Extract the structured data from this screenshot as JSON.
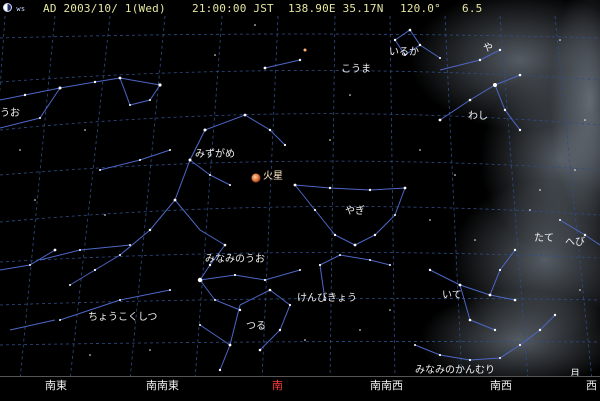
{
  "statusbar": {
    "moon_age": " ws",
    "date": "AD 2003/10/ 1(Wed)",
    "time": "21:00:00 JST",
    "coords": "138.90E 35.17N",
    "view_angle": "120.0°",
    "limit_mag": "6.5"
  },
  "labels": {
    "uo": "うお",
    "kouma": "こうま",
    "iruka": "いるか",
    "ya": "や",
    "washi": "わし",
    "mizugame": "みずがめ",
    "mars": "火星",
    "yagi": "やぎ",
    "tate": "たて",
    "hebi": "へび",
    "minaminouo": "みなみのうお",
    "kenbikyou": "けんびきょう",
    "ite": "いて",
    "choukokushitsu": "ちょうこくしつ",
    "tsuru": "つる",
    "minaminokanmuri": "みなみのかんむり",
    "tsuki": "月"
  },
  "directions": {
    "se": "南東",
    "sse": "南南東",
    "s": "南",
    "ssw": "南南西",
    "sw": "南西",
    "w_partial": "西"
  },
  "colors": {
    "background": "#000000",
    "grid": "#2f4d86",
    "constellation_lines": "#4d67c7",
    "milky_way": "#8e9aa8",
    "mars": "#e07a40",
    "south_marker": "#ff3a3a",
    "status_text": "#e6e6a0"
  }
}
